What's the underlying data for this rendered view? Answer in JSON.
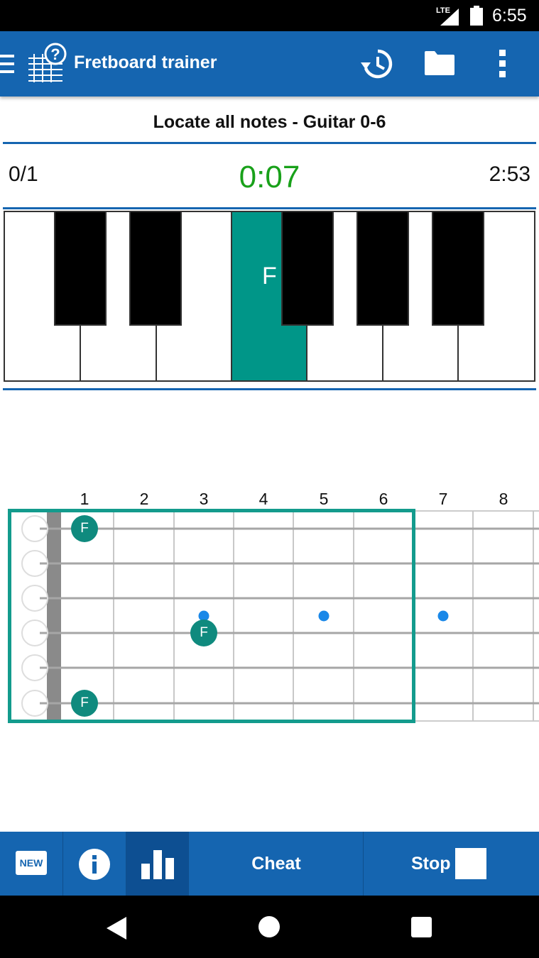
{
  "status_bar": {
    "network": "LTE",
    "time": "6:55"
  },
  "app_bar": {
    "title": "Fretboard trainer",
    "icons": [
      "menu-icon",
      "fretboard-help-icon",
      "history-icon",
      "folder-icon",
      "more-vert-icon"
    ]
  },
  "exercise": {
    "title": "Locate all notes - Guitar 0-6"
  },
  "stats": {
    "score": "0/1",
    "elapsed": "0:07",
    "remaining": "2:53"
  },
  "piano": {
    "active_label": "F"
  },
  "fretboard": {
    "fret_numbers": [
      "1",
      "2",
      "3",
      "4",
      "5",
      "6",
      "7",
      "8"
    ],
    "markers": [
      {
        "label": "F",
        "string": 1,
        "fret": 1
      },
      {
        "label": "F",
        "string": 4,
        "fret": 3
      },
      {
        "label": "F",
        "string": 6,
        "fret": 1
      }
    ],
    "inlay_frets": [
      3,
      5,
      7
    ],
    "range": "0-6"
  },
  "toolbar": {
    "new_label": "NEW",
    "cheat_label": "Cheat",
    "stop_label": "Stop",
    "icons": [
      "new-icon",
      "info-icon",
      "stats-chart-icon",
      "stop-square-icon"
    ]
  },
  "colors": {
    "primary": "#1565b0",
    "accent": "#009688",
    "timer": "#19a11a",
    "inlay": "#1a88e8"
  }
}
